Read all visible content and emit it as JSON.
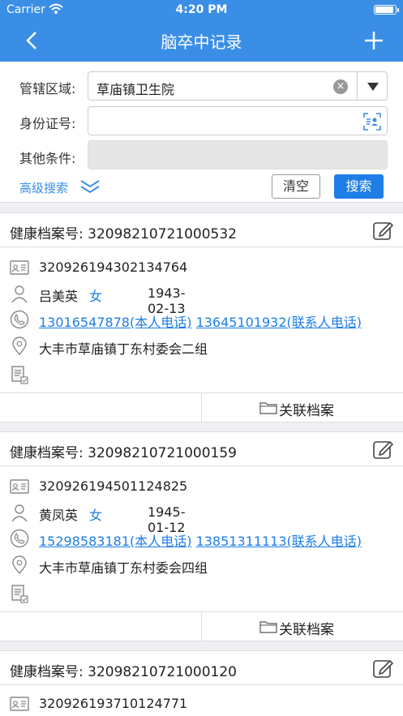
{
  "status": {
    "carrier": "Carrier",
    "time": "4:20 PM"
  },
  "nav": {
    "title": "脑卒中记录"
  },
  "search": {
    "region_label": "管辖区域:",
    "region_value": "草庙镇卫生院",
    "id_label": "身份证号:",
    "id_value": "",
    "other_label": "其他条件:",
    "other_value": "",
    "advanced_label": "高级搜索",
    "clear_label": "清空",
    "search_label": "搜索"
  },
  "records": [
    {
      "health_no": "健康档案号:  32098210721000532",
      "id_number": "320926194302134764",
      "name": "吕美英",
      "gender": "女",
      "dob": "1943-02-13",
      "phone_self": "13016547878(本人电话)",
      "phone_contact": "13645101932(联系人电话)",
      "address": "大丰市草庙镇丁东村委会二组",
      "link_label": "关联档案"
    },
    {
      "health_no": "健康档案号:  32098210721000159",
      "id_number": "320926194501124825",
      "name": "黄凤英",
      "gender": "女",
      "dob": "1945-01-12",
      "phone_self": "15298583181(本人电话)",
      "phone_contact": "13851311113(联系人电话)",
      "address": "大丰市草庙镇丁东村委会四组",
      "link_label": "关联档案"
    },
    {
      "health_no": "健康档案号:  32098210721000120",
      "id_number": "320926193710124771"
    }
  ]
}
